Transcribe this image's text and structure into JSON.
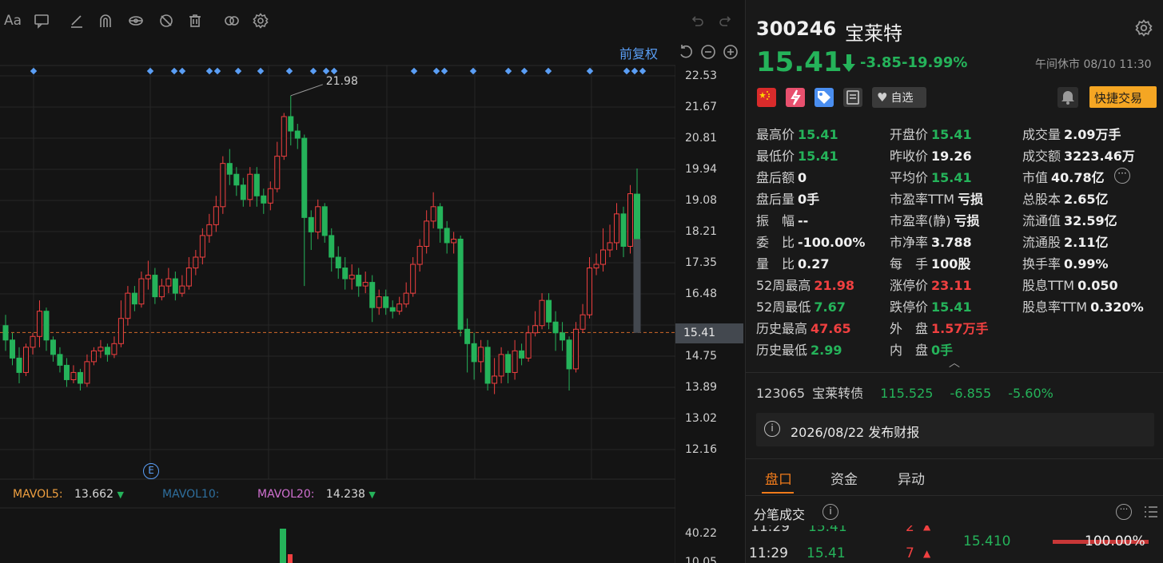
{
  "chart": {
    "restore_label": "前复权",
    "price_ticks": [
      "22.53",
      "21.67",
      "20.81",
      "19.94",
      "19.08",
      "18.21",
      "17.35",
      "16.48",
      "15.41",
      "14.75",
      "13.89",
      "13.02",
      "12.16"
    ],
    "current_price_tag": "15.41",
    "high_annotation": "21.98",
    "event_marker": "E",
    "mavol": [
      {
        "label": "MAVOL5:",
        "value": "13.662",
        "color": "#f0a040"
      },
      {
        "label": "MAVOL10:",
        "value": "",
        "color": "#2e6f9e"
      },
      {
        "label": "MAVOL20:",
        "value": "14.238",
        "color": "#d070d0"
      }
    ],
    "vol_ticks": [
      "40.22",
      "10.05"
    ],
    "up_color": "#f04040",
    "down_color": "#25b35a"
  },
  "chart_data": {
    "type": "candlestick",
    "ylim": [
      12.16,
      22.53
    ],
    "candles": [
      [
        15.6,
        15.2,
        15.9,
        14.9
      ],
      [
        15.2,
        14.7,
        15.4,
        14.5
      ],
      [
        14.7,
        14.3,
        15.0,
        14.0
      ],
      [
        14.3,
        15.0,
        15.1,
        14.2
      ],
      [
        15.0,
        15.3,
        15.4,
        14.8
      ],
      [
        15.3,
        16.0,
        16.3,
        15.0
      ],
      [
        16.0,
        15.2,
        16.1,
        14.9
      ],
      [
        15.2,
        14.8,
        15.3,
        14.6
      ],
      [
        14.8,
        14.5,
        15.0,
        14.3
      ],
      [
        14.5,
        14.1,
        14.7,
        13.9
      ],
      [
        14.1,
        14.3,
        14.5,
        14.0
      ],
      [
        14.3,
        14.0,
        14.4,
        13.8
      ],
      [
        14.0,
        14.6,
        14.8,
        13.9
      ],
      [
        14.6,
        14.9,
        15.0,
        14.5
      ],
      [
        14.9,
        15.0,
        15.2,
        14.7
      ],
      [
        15.0,
        14.8,
        15.1,
        14.6
      ],
      [
        14.8,
        15.1,
        15.3,
        14.7
      ],
      [
        15.1,
        15.8,
        16.3,
        15.0
      ],
      [
        15.8,
        16.5,
        16.7,
        15.6
      ],
      [
        16.5,
        16.2,
        16.7,
        16.0
      ],
      [
        16.2,
        16.9,
        17.1,
        16.1
      ],
      [
        16.9,
        17.0,
        17.4,
        16.6
      ],
      [
        17.0,
        16.4,
        17.2,
        16.2
      ],
      [
        16.4,
        16.7,
        16.9,
        16.3
      ],
      [
        16.7,
        16.9,
        17.2,
        16.5
      ],
      [
        16.9,
        16.5,
        17.1,
        16.3
      ],
      [
        16.5,
        16.7,
        17.0,
        16.4
      ],
      [
        16.7,
        17.2,
        17.5,
        16.6
      ],
      [
        17.2,
        17.5,
        17.7,
        17.0
      ],
      [
        17.5,
        18.1,
        18.3,
        17.3
      ],
      [
        18.1,
        18.4,
        18.7,
        17.9
      ],
      [
        18.4,
        18.9,
        19.2,
        18.2
      ],
      [
        18.9,
        20.1,
        20.3,
        18.7
      ],
      [
        20.1,
        19.8,
        20.5,
        19.5
      ],
      [
        19.8,
        19.5,
        20.0,
        19.2
      ],
      [
        19.5,
        19.1,
        19.7,
        18.9
      ],
      [
        19.1,
        19.8,
        20.0,
        18.9
      ],
      [
        19.8,
        19.2,
        20.0,
        18.9
      ],
      [
        19.2,
        19.0,
        19.4,
        18.7
      ],
      [
        19.0,
        19.4,
        19.6,
        18.8
      ],
      [
        19.4,
        20.3,
        20.7,
        19.3
      ],
      [
        20.3,
        21.4,
        21.5,
        20.2
      ],
      [
        21.4,
        21.0,
        21.98,
        20.6
      ],
      [
        21.0,
        20.8,
        21.2,
        20.5
      ],
      [
        20.8,
        18.6,
        20.9,
        16.7
      ],
      [
        18.6,
        18.2,
        18.8,
        17.7
      ],
      [
        18.2,
        18.9,
        19.1,
        18.0
      ],
      [
        18.9,
        18.1,
        19.0,
        17.9
      ],
      [
        18.1,
        17.5,
        18.3,
        17.1
      ],
      [
        17.5,
        17.2,
        17.8,
        16.9
      ],
      [
        17.2,
        16.9,
        17.5,
        16.6
      ],
      [
        16.9,
        17.0,
        17.3,
        16.6
      ],
      [
        17.0,
        16.7,
        17.2,
        16.4
      ],
      [
        16.7,
        16.8,
        17.1,
        16.5
      ],
      [
        16.8,
        16.1,
        17.0,
        15.7
      ],
      [
        16.1,
        16.4,
        16.6,
        15.9
      ],
      [
        16.4,
        16.1,
        16.6,
        15.9
      ],
      [
        16.1,
        16.0,
        16.3,
        15.8
      ],
      [
        16.0,
        16.2,
        16.4,
        15.9
      ],
      [
        16.2,
        16.5,
        16.8,
        16.1
      ],
      [
        16.5,
        17.3,
        17.5,
        16.4
      ],
      [
        17.3,
        17.8,
        18.0,
        17.1
      ],
      [
        17.8,
        18.5,
        18.8,
        17.6
      ],
      [
        18.5,
        18.9,
        19.3,
        18.3
      ],
      [
        18.9,
        18.3,
        19.0,
        17.9
      ],
      [
        18.3,
        17.9,
        18.5,
        17.6
      ],
      [
        17.9,
        18.0,
        18.2,
        17.6
      ],
      [
        18.0,
        15.5,
        18.1,
        15.3
      ],
      [
        15.5,
        15.1,
        15.8,
        14.3
      ],
      [
        15.1,
        14.6,
        15.4,
        14.1
      ],
      [
        14.6,
        15.0,
        15.2,
        14.3
      ],
      [
        15.0,
        14.0,
        15.2,
        13.8
      ],
      [
        14.0,
        14.2,
        14.7,
        13.7
      ],
      [
        14.2,
        14.8,
        15.0,
        14.0
      ],
      [
        14.8,
        14.3,
        14.9,
        14.0
      ],
      [
        14.3,
        14.9,
        15.2,
        14.1
      ],
      [
        14.9,
        14.7,
        15.1,
        14.5
      ],
      [
        14.7,
        15.4,
        15.6,
        14.6
      ],
      [
        15.4,
        15.6,
        16.0,
        15.3
      ],
      [
        15.6,
        16.3,
        16.5,
        15.5
      ],
      [
        16.3,
        15.7,
        16.5,
        15.5
      ],
      [
        15.7,
        15.4,
        16.0,
        14.9
      ],
      [
        15.4,
        15.2,
        15.7,
        14.9
      ],
      [
        15.2,
        14.4,
        15.3,
        13.8
      ],
      [
        14.4,
        15.5,
        15.7,
        14.3
      ],
      [
        15.5,
        15.9,
        16.2,
        15.4
      ],
      [
        15.9,
        17.2,
        17.5,
        15.8
      ],
      [
        17.2,
        17.3,
        17.6,
        17.0
      ],
      [
        17.3,
        17.7,
        18.3,
        17.1
      ],
      [
        17.7,
        17.9,
        18.4,
        17.5
      ],
      [
        17.9,
        18.7,
        19.0,
        17.7
      ],
      [
        18.7,
        17.8,
        18.9,
        17.5
      ],
      [
        17.8,
        19.26,
        19.5,
        17.6
      ],
      [
        19.26,
        15.41,
        19.96,
        15.41
      ]
    ],
    "markers": [
      42,
      188,
      218,
      228,
      262,
      272,
      298,
      326,
      362,
      392,
      408,
      418,
      518,
      546,
      556,
      592,
      636,
      656,
      686,
      738,
      784,
      794,
      804
    ]
  },
  "volume_chart": {
    "type": "bar",
    "bars": [
      {
        "color": "down",
        "value": 40.22
      },
      {
        "color": "up",
        "value": 10.05
      }
    ]
  },
  "stock": {
    "code": "300246",
    "name": "宝莱特",
    "price": "15.41",
    "change_abs": "-3.85",
    "change_pct": "-19.99%",
    "status_time": "午间休市 08/10 11:30",
    "watch_label": "自选",
    "quick_trade_label": "快捷交易"
  },
  "stats": {
    "col1": [
      {
        "label": "最高价",
        "value": "15.41",
        "c": "g"
      },
      {
        "label": "最低价",
        "value": "15.41",
        "c": "g"
      },
      {
        "label": "盘后额",
        "value": "0",
        "c": "w"
      },
      {
        "label": "盘后量",
        "value": "0手",
        "c": "w"
      },
      {
        "label": "振　幅",
        "value": "--",
        "c": "w"
      },
      {
        "label": "委　比",
        "value": "-100.00%",
        "c": "w"
      },
      {
        "label": "量　比",
        "value": "0.27",
        "c": "w"
      },
      {
        "label": "52周最高",
        "value": "21.98",
        "c": "r"
      },
      {
        "label": "52周最低",
        "value": "7.67",
        "c": "g"
      },
      {
        "label": "历史最高",
        "value": "47.65",
        "c": "r"
      },
      {
        "label": "历史最低",
        "value": "2.99",
        "c": "g"
      }
    ],
    "col2": [
      {
        "label": "开盘价",
        "value": "15.41",
        "c": "g"
      },
      {
        "label": "昨收价",
        "value": "19.26",
        "c": "w"
      },
      {
        "label": "平均价",
        "value": "15.41",
        "c": "g"
      },
      {
        "label": "市盈率TTM",
        "value": "亏损",
        "c": "w"
      },
      {
        "label": "市盈率(静)",
        "value": "亏损",
        "c": "w"
      },
      {
        "label": "市净率",
        "value": "3.788",
        "c": "w"
      },
      {
        "label": "每　手",
        "value": "100股",
        "c": "w"
      },
      {
        "label": "涨停价",
        "value": "23.11",
        "c": "r"
      },
      {
        "label": "跌停价",
        "value": "15.41",
        "c": "g"
      },
      {
        "label": "外　盘",
        "value": "1.57万手",
        "c": "r"
      },
      {
        "label": "内　盘",
        "value": "0手",
        "c": "g"
      }
    ],
    "col3": [
      {
        "label": "成交量",
        "value": "2.09万手",
        "c": "w"
      },
      {
        "label": "成交额",
        "value": "3223.46万",
        "c": "w"
      },
      {
        "label": "市值",
        "value": "40.78亿",
        "c": "w"
      },
      {
        "label": "总股本",
        "value": "2.65亿",
        "c": "w"
      },
      {
        "label": "流通值",
        "value": "32.59亿",
        "c": "w"
      },
      {
        "label": "流通股",
        "value": "2.11亿",
        "c": "w"
      },
      {
        "label": "换手率",
        "value": "0.99%",
        "c": "w"
      },
      {
        "label": "股息TTM",
        "value": "0.050",
        "c": "w"
      },
      {
        "label": "股息率TTM",
        "value": "0.320%",
        "c": "w"
      }
    ]
  },
  "bond": {
    "code": "123065",
    "name": "宝莱转债",
    "price": "115.525",
    "change": "-6.855",
    "pct": "-5.60%"
  },
  "report": {
    "text": "2026/08/22  发布财报"
  },
  "tabs": [
    {
      "label": "盘口",
      "active": true
    },
    {
      "label": "资金",
      "active": false
    },
    {
      "label": "异动",
      "active": false
    }
  ],
  "ticks": {
    "title": "分笔成交",
    "rows": [
      {
        "time": "11:29",
        "price": "15.41",
        "vol": "2"
      },
      {
        "time": "11:29",
        "price": "15.41",
        "vol": "7"
      }
    ],
    "depth_price": "15.410",
    "depth_pct": "100.00%"
  }
}
